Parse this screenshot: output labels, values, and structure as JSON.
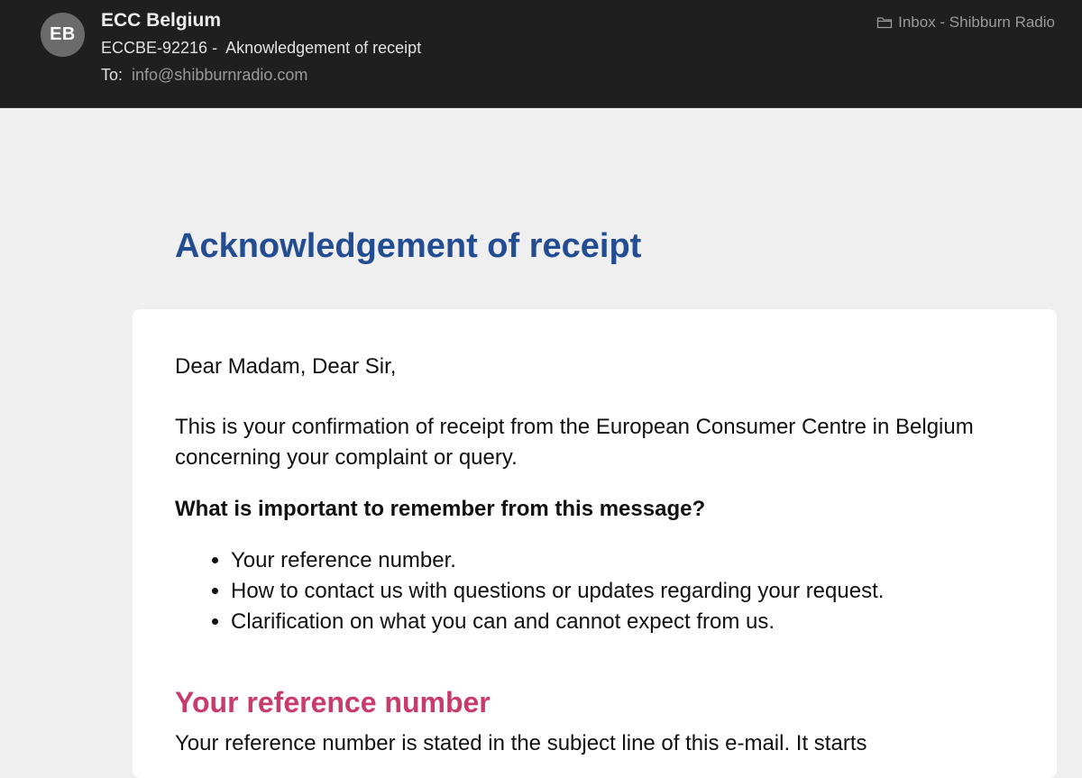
{
  "header": {
    "avatar_initials": "EB",
    "sender": "ECC Belgium",
    "subject": "ECCBE-92216 -  Aknowledgement of receipt",
    "to_label": "To:",
    "to_address": "info@shibburnradio.com",
    "mailbox": "Inbox - Shibburn Radio",
    "mailbox_icon": "folder-icon"
  },
  "email": {
    "title": "Acknowledgement of receipt",
    "greeting": "Dear Madam, Dear Sir,",
    "intro": "This is your confirmation of receipt from the European Consumer Centre in Belgium concerning your complaint or query.",
    "important_heading": "What is important to remember from this message?",
    "bullets": [
      "Your reference number.",
      "How to contact us with questions or updates regarding your request.",
      "Clarification on what you can and cannot expect from us."
    ],
    "section_heading": "Your reference number",
    "section_text": "Your reference number is stated in the subject line of this e-mail. It starts"
  },
  "colors": {
    "header_bg": "#1f1f1f",
    "page_bg": "#efefef",
    "title_blue": "#234d93",
    "section_pink": "#c93b6a"
  }
}
